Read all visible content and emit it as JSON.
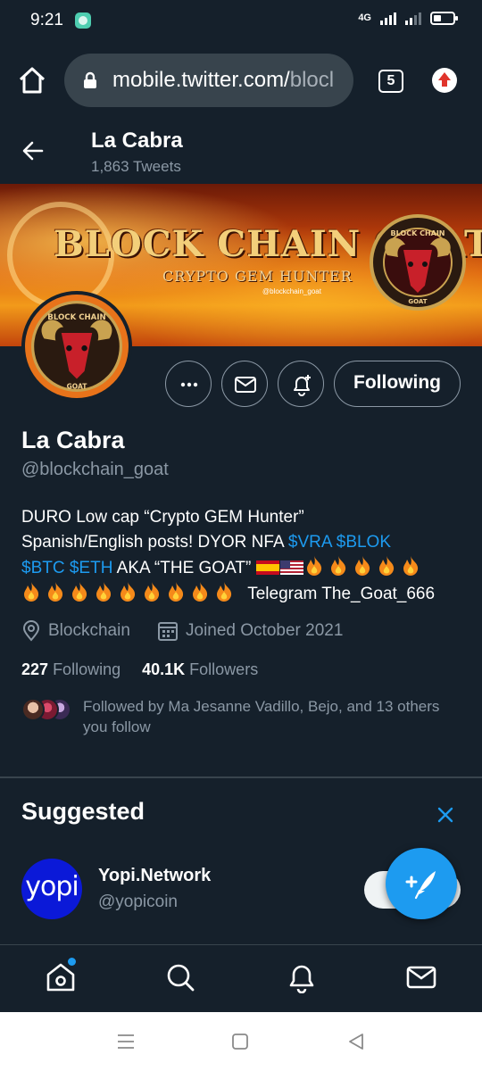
{
  "status_bar": {
    "time": "9:21",
    "network": "4G"
  },
  "browser": {
    "url_main": "mobile.twitter.com/",
    "url_tail": "blocl",
    "tab_count": "5"
  },
  "header": {
    "name": "La Cabra",
    "tweet_count": "1,863 Tweets"
  },
  "banner": {
    "title": "BLOCK CHAIN GOAT",
    "subtitle": "CRYPTO GEM HUNTER",
    "handle": "@blockchain_goat",
    "logo_top_text": "BLOCK CHAIN",
    "logo_bottom_text": "GOAT"
  },
  "profile": {
    "name": "La Cabra",
    "handle": "@blockchain_goat",
    "follow_label": "Following",
    "bio": {
      "line1": "DURO Low cap “Crypto GEM Hunter”",
      "line2_text": "Spanish/English posts! DYOR NFA ",
      "vra": "$VRA",
      "blok": "$BLOK",
      "btc": "$BTC",
      "eth": "$ETH",
      "aka": " AKA “THE GOAT” ",
      "telegram": "Telegram The_Goat_666"
    },
    "location": "Blockchain",
    "joined": "Joined October 2021",
    "following_count": "227",
    "following_label": "Following",
    "followers_count": "40.1K",
    "followers_label": "Followers",
    "followed_by": "Followed by Ma Jesanne Vadillo, Bejo, and 13 others you follow"
  },
  "suggested": {
    "title": "Suggested",
    "account": {
      "name": "Yopi.Network",
      "handle": "@yopicoin",
      "avatar_text": "yopi"
    }
  },
  "colors": {
    "background": "#15202b",
    "accent": "#1d9bf0",
    "secondary_text": "#8b98a5",
    "border": "#38444d"
  },
  "icons": [
    "home-icon",
    "lock-icon",
    "tabs-icon",
    "update-icon",
    "back-arrow-icon",
    "more-icon",
    "mail-icon",
    "bell-plus-icon",
    "location-icon",
    "calendar-icon",
    "close-icon",
    "compose-icon",
    "search-icon",
    "bell-icon",
    "recent-apps-icon",
    "home-square-icon",
    "back-triangle-icon"
  ]
}
